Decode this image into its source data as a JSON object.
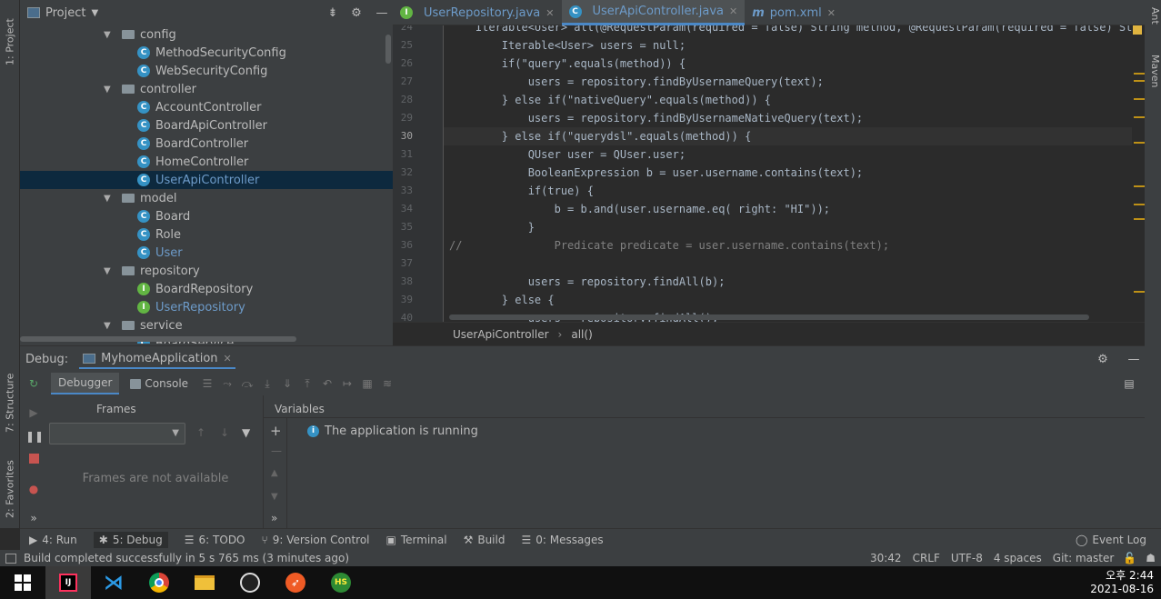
{
  "sidebar_left": {
    "project_tab": "1: Project",
    "structure_tab": "7: Structure",
    "favorites_tab": "2: Favorites"
  },
  "sidebar_right": {
    "ant_tab": "Ant",
    "maven_tab": "Maven"
  },
  "project": {
    "title": "Project",
    "tree": [
      {
        "label": "config",
        "type": "folder",
        "indent": 0
      },
      {
        "label": "MethodSecurityConfig",
        "type": "class",
        "indent": 1
      },
      {
        "label": "WebSecurityConfig",
        "type": "class",
        "indent": 1
      },
      {
        "label": "controller",
        "type": "folder",
        "indent": 0
      },
      {
        "label": "AccountController",
        "type": "class",
        "indent": 1
      },
      {
        "label": "BoardApiController",
        "type": "class",
        "indent": 1
      },
      {
        "label": "BoardController",
        "type": "class",
        "indent": 1
      },
      {
        "label": "HomeController",
        "type": "class",
        "indent": 1
      },
      {
        "label": "UserApiController",
        "type": "class",
        "indent": 1,
        "selected": true
      },
      {
        "label": "model",
        "type": "folder",
        "indent": 0
      },
      {
        "label": "Board",
        "type": "class",
        "indent": 1
      },
      {
        "label": "Role",
        "type": "class",
        "indent": 1
      },
      {
        "label": "User",
        "type": "class",
        "indent": 1
      },
      {
        "label": "repository",
        "type": "folder",
        "indent": 0
      },
      {
        "label": "BoardRepository",
        "type": "interface",
        "indent": 1
      },
      {
        "label": "UserRepository",
        "type": "interface",
        "indent": 1
      },
      {
        "label": "service",
        "type": "folder",
        "indent": 0
      },
      {
        "label": "BoardService",
        "type": "class",
        "indent": 1
      }
    ]
  },
  "editor_tabs": [
    {
      "label": "UserRepository.java",
      "icon": "interface-icon"
    },
    {
      "label": "UserApiController.java",
      "icon": "class-icon",
      "active": true
    },
    {
      "label": "pom.xml",
      "icon": "maven-icon"
    }
  ],
  "code_lines": [
    {
      "n": "24",
      "text": "    Iterable<User> all(@RequestParam(required = false) String method, @RequestParam(required = false) String text"
    },
    {
      "n": "25",
      "text": "        Iterable<User> users = null;"
    },
    {
      "n": "26",
      "text": "        if(\"query\".equals(method)) {"
    },
    {
      "n": "27",
      "text": "            users = repository.findByUsernameQuery(text);"
    },
    {
      "n": "28",
      "text": "        } else if(\"nativeQuery\".equals(method)) {"
    },
    {
      "n": "29",
      "text": "            users = repository.findByUsernameNativeQuery(text);"
    },
    {
      "n": "30",
      "text": "        } else if(\"querydsl\".equals(method)) {"
    },
    {
      "n": "31",
      "text": "            QUser user = QUser.user;"
    },
    {
      "n": "32",
      "text": "            BooleanExpression b = user.username.contains(text);"
    },
    {
      "n": "33",
      "text": "            if(true) {"
    },
    {
      "n": "34",
      "text": "                b = b.and(user.username.eq( right: \"HI\"));"
    },
    {
      "n": "35",
      "text": "            }"
    },
    {
      "n": "36",
      "text": "//              Predicate predicate = user.username.contains(text);"
    },
    {
      "n": "37",
      "text": ""
    },
    {
      "n": "38",
      "text": "            users = repository.findAll(b);"
    },
    {
      "n": "39",
      "text": "        } else {"
    },
    {
      "n": "40",
      "text": "            users = repository.findAll();"
    }
  ],
  "breadcrumb": {
    "class": "UserApiController",
    "method": "all()"
  },
  "debug": {
    "label": "Debug:",
    "config": "MyhomeApplication",
    "tab_debugger": "Debugger",
    "tab_console": "Console",
    "frames_title": "Frames",
    "frames_empty": "Frames are not available",
    "variables_title": "Variables",
    "running_msg": "The application is running"
  },
  "bottom_tools": [
    {
      "label": "4: Run",
      "icon": "run-icon"
    },
    {
      "label": "5: Debug",
      "icon": "debug-icon",
      "active": true
    },
    {
      "label": "6: TODO",
      "icon": "todo-icon"
    },
    {
      "label": "9: Version Control",
      "icon": "vcs-icon"
    },
    {
      "label": "Terminal",
      "icon": "terminal-icon"
    },
    {
      "label": "Build",
      "icon": "build-icon"
    },
    {
      "label": "0: Messages",
      "icon": "messages-icon"
    }
  ],
  "event_log": "Event Log",
  "status": {
    "message": "Build completed successfully in 5 s 765 ms (3 minutes ago)",
    "position": "30:42",
    "line_sep": "CRLF",
    "encoding": "UTF-8",
    "indent": "4 spaces",
    "git": "Git: master"
  },
  "taskbar": {
    "time": "오후 2:44",
    "date": "2021-08-16"
  },
  "colors": {
    "accent": "#4a88c7",
    "bg": "#2b2b2b",
    "panel": "#3c3f41",
    "selection": "#0d293e"
  }
}
